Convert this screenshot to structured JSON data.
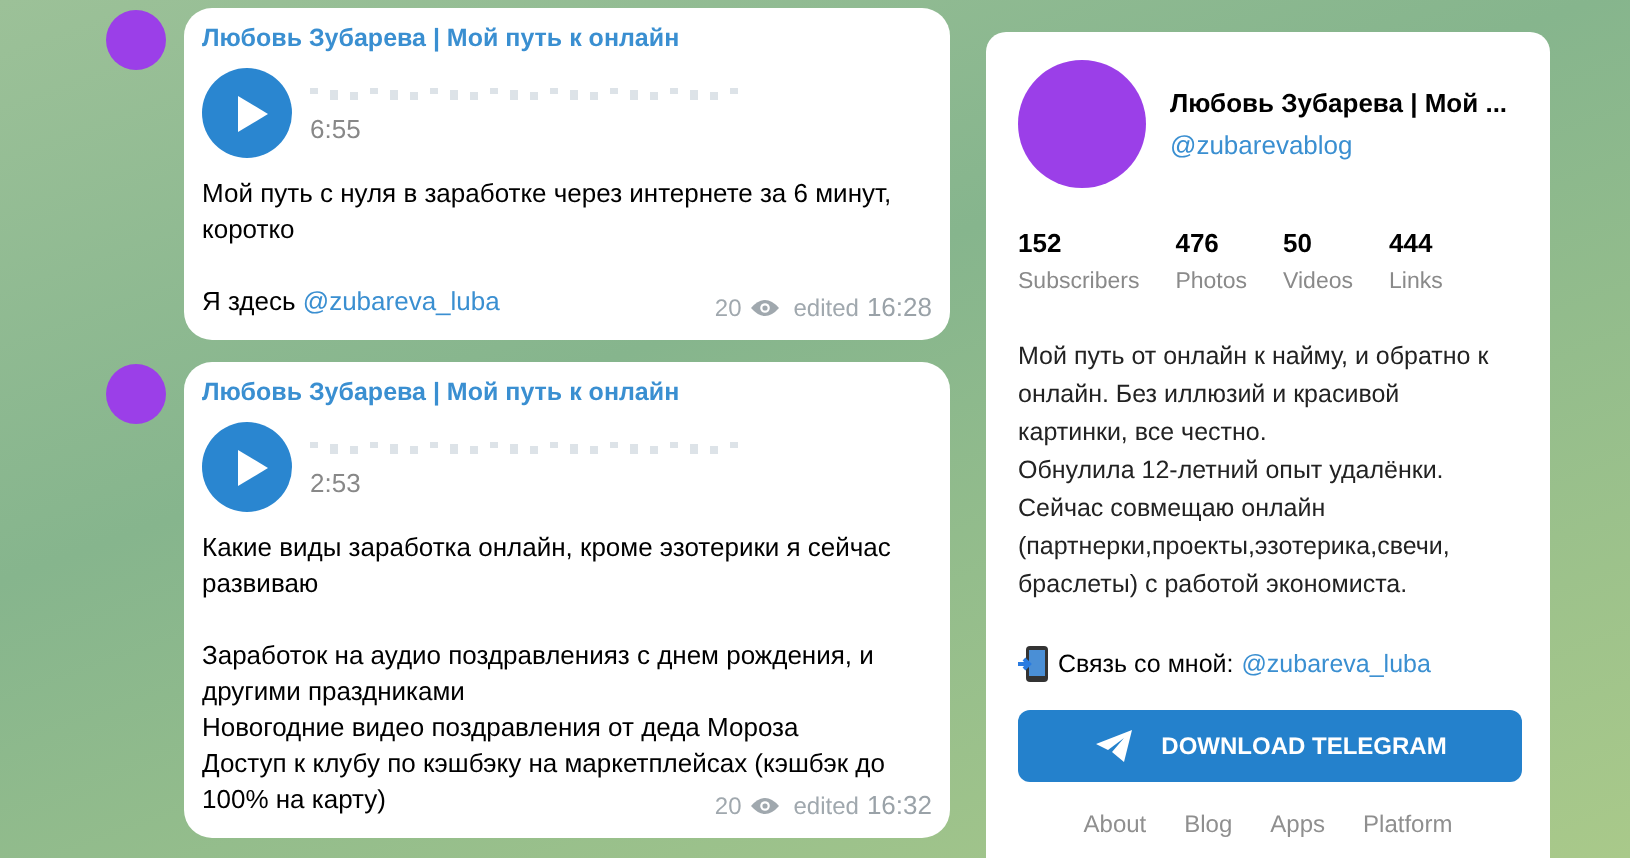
{
  "messages": [
    {
      "author": "Любовь Зубарева | Мой путь к онлайн",
      "duration": "6:55",
      "blocks": [
        [
          {
            "text": "Мой путь с нуля в заработке через интернете за 6 минут, коротко"
          }
        ],
        [
          {
            "text": "Я здесь ",
            "link": "@zubareva_luba"
          }
        ]
      ],
      "views": "20",
      "edited": "edited",
      "time": "16:28"
    },
    {
      "author": "Любовь Зубарева | Мой путь к онлайн",
      "duration": "2:53",
      "blocks": [
        [
          {
            "text": "Какие виды заработка онлайн, кроме эзотерики я сейчас развиваю"
          }
        ],
        [
          {
            "text": "Заработок на аудио поздравленияз с днем рождения, и другими праздниками"
          },
          {
            "text": "Новогодние видео поздравления от деда Мороза"
          },
          {
            "text": "Доступ к клубу по кэшбэку на маркетплейсах (кэшбэк до"
          },
          {
            "text": "100% на карту)"
          }
        ]
      ],
      "views": "20",
      "edited": "edited",
      "time": "16:32"
    }
  ],
  "channel": {
    "name": "Любовь Зубарева | Мой ...",
    "username": "@zubarevablog",
    "stats": [
      {
        "value": "152",
        "label": "Subscribers"
      },
      {
        "value": "476",
        "label": "Photos"
      },
      {
        "value": "50",
        "label": "Videos"
      },
      {
        "value": "444",
        "label": "Links"
      }
    ],
    "description": [
      "Мой путь от онлайн к найму, и обратно к онлайн. Без иллюзий и красивой картинки, все честно.",
      "Обнулила 12-летний опыт удалёнки.",
      "Сейчас совмещаю онлайн (партнерки,проекты,эзотерика,свечи, браслеты) с работой экономиста."
    ],
    "contact": {
      "text": "Связь со мной:",
      "link": "@zubareva_luba"
    },
    "button": "DOWNLOAD TELEGRAM",
    "footer_links": [
      "About",
      "Blog",
      "Apps",
      "Platform"
    ]
  }
}
